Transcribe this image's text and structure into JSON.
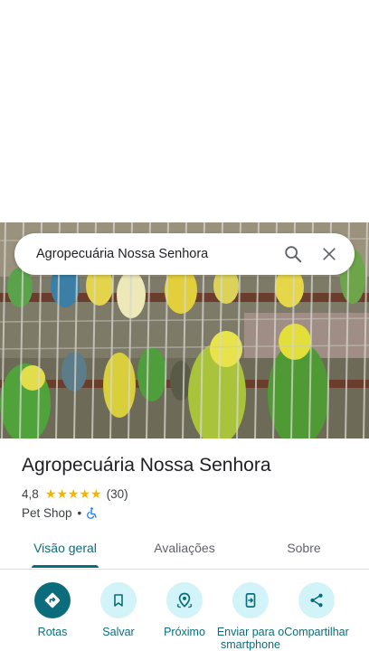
{
  "search": {
    "query": "Agropecuária Nossa Senhora"
  },
  "place": {
    "name": "Agropecuária Nossa Senhora",
    "rating": "4,8",
    "stars": 5,
    "review_count": "(30)",
    "category": "Pet Shop",
    "separator": "•",
    "accessibility_icon": "wheelchair-icon"
  },
  "tabs": [
    {
      "label": "Visão geral",
      "active": true
    },
    {
      "label": "Avaliações",
      "active": false
    },
    {
      "label": "Sobre",
      "active": false
    }
  ],
  "actions": [
    {
      "label": "Rotas",
      "icon": "directions-icon"
    },
    {
      "label": "Salvar",
      "icon": "bookmark-icon"
    },
    {
      "label": "Próximo",
      "icon": "nearby-icon"
    },
    {
      "label": "Enviar para o smartphone",
      "icon": "send-to-phone-icon"
    },
    {
      "label": "Compartilhar",
      "icon": "share-icon"
    }
  ],
  "colors": {
    "accent": "#0b6d7b",
    "action_bg": "#d2f3f7",
    "star": "#f4b400"
  }
}
